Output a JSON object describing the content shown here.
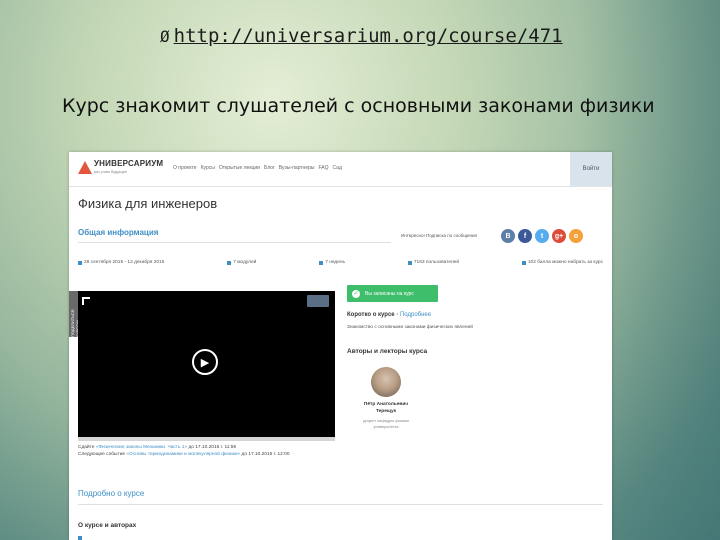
{
  "slide": {
    "bullet": "Ø",
    "url": "http://universarium.org/course/471",
    "caption": "Курс знакомит слушателей с основными законами физики"
  },
  "screenshot": {
    "logo": {
      "brand": "УНИВЕРСАРИУМ",
      "tagline": "мы учим будущее"
    },
    "nav": [
      "О проекте",
      "Курсы",
      "Открытые лекции",
      "Блог",
      "Вузы-партнеры",
      "FAQ",
      "Сад"
    ],
    "login_label": "Войти",
    "page_title": "Физика для инженеров",
    "section_tab": "Общая информация",
    "wishlist": "Интересно! Подписка по сообщения",
    "social_icons": [
      {
        "name": "vk-icon",
        "glyph": "B",
        "color": "#5b7fa6"
      },
      {
        "name": "facebook-icon",
        "glyph": "f",
        "color": "#3b5998"
      },
      {
        "name": "twitter-icon",
        "glyph": "t",
        "color": "#55acee"
      },
      {
        "name": "googleplus-icon",
        "glyph": "g+",
        "color": "#dd4b39"
      },
      {
        "name": "odnoklassniki-icon",
        "glyph": "o",
        "color": "#f4a13b"
      }
    ],
    "facts": [
      "28 сентября 2015 - 12 декабря 2015",
      "7 модулей",
      "7 недель",
      "7163 пользователей",
      "102 балла можно набрать за курс"
    ],
    "share_strip_label": "ПОДЕЛИТЬСЯ КУРСОМ",
    "deadline_prefix": "Сдайте",
    "deadline_link": "«Физические законы Механики. Часть 1»",
    "deadline_rest": "до 17.10.2015 г. 11:59",
    "next_event_prefix": "Следующее событие",
    "next_event_link": "«Основы термодинамики и молекулярной физики»",
    "next_event_rest": "до 17.10.2015 г. 12:00",
    "cta_label": "Вы записаны на курс",
    "about_tab_active": "Коротко о курсе",
    "about_tab_more": "Подробнее",
    "about_text": "Знакомство с основными законами физических явлений",
    "authors_title": "Авторы и лекторы курса",
    "author_name": "Пётр Анатольевич Терещук",
    "author_role": "доцент кафедры физики университета",
    "more_title": "Подробно о курсе",
    "course_about": "О курсе и авторах"
  }
}
